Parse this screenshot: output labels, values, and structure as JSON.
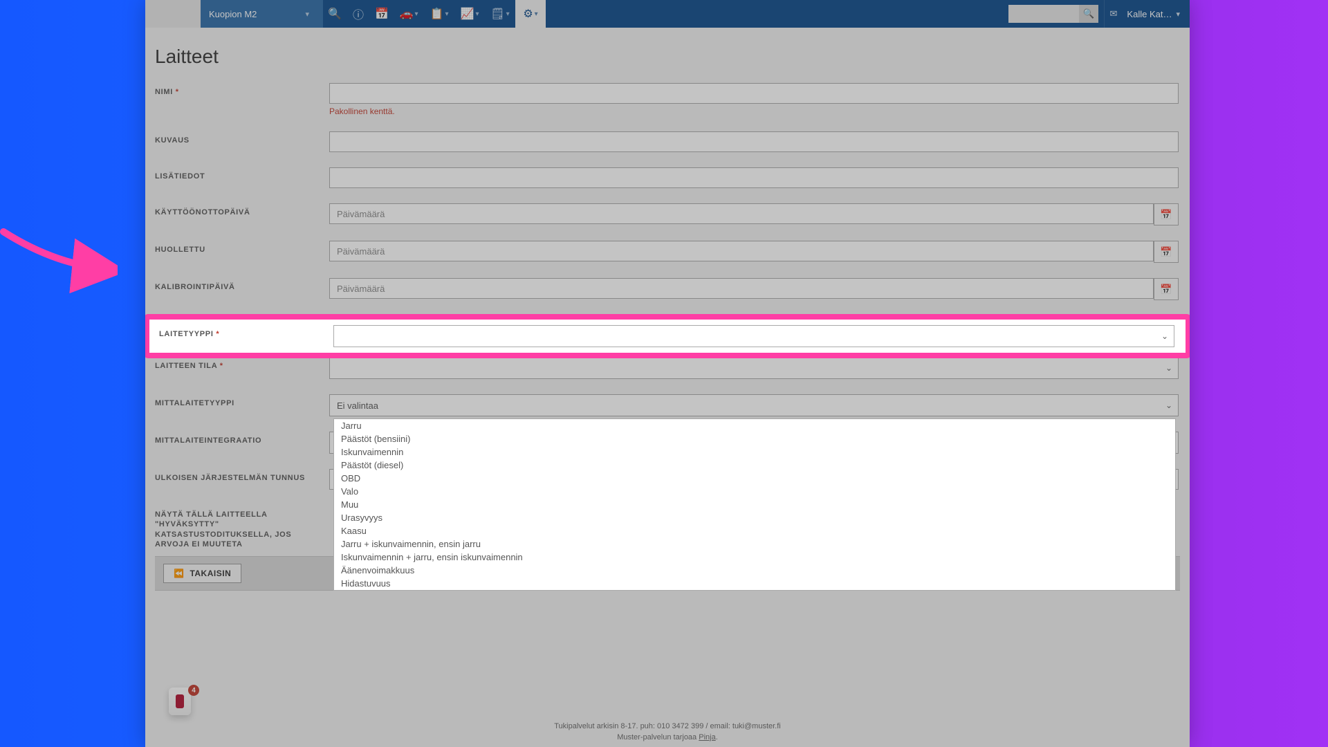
{
  "nav": {
    "station_label": "Kuopion M2",
    "search_placeholder": "",
    "user_name": "Kalle Kat…"
  },
  "page": {
    "title": "Laitteet",
    "error_required": "Pakollinen kenttä."
  },
  "labels": {
    "nimi": "NIMI",
    "kuvaus": "KUVAUS",
    "lisatiedot": "LISÄTIEDOT",
    "kayttoonotto": "KÄYTTÖÖNOTTOPÄIVÄ",
    "huollettu": "HUOLLETTU",
    "kalibrointi": "KALIBROINTIPÄIVÄ",
    "laitetyyppi": "LAITETYYPPI",
    "laitteen_tila": "LAITTEEN TILA",
    "mittalaitetyyppi": "MITTALAITETYYPPI",
    "mittalaiteintegraatio": "MITTALAITEINTEGRAATIO",
    "ulkoinen_tunnus": "ULKOISEN JÄRJESTELMÄN TUNNUS",
    "hyvaksytty_label": "NÄYTÄ TÄLLÄ LAITTEELLA \"HYVÄKSYTTY\" KATSASTUSTODITUKSELLA, JOS ARVOJA EI MUUTETA"
  },
  "placeholders": {
    "date": "Päivämäärä",
    "ei_valintaa": "Ei valintaa"
  },
  "laitetyyppi_options": [
    "Jarru",
    "Päästöt (bensiini)",
    "Iskunvaimennin",
    "Päästöt (diesel)",
    "OBD",
    "Valo",
    "Muu",
    "Urasyvyys",
    "Kaasu",
    "Jarru + iskunvaimennin, ensin jarru",
    "Iskunvaimennin + jarru, ensin iskunvaimennin",
    "Äänenvoimakkuus",
    "Hidastuvuus"
  ],
  "buttons": {
    "back": "TAKAISIN"
  },
  "footer": {
    "line1": "Tukipalvelut arkisin 8-17. puh: 010 3472 399 / email: tuki@muster.fi",
    "line2_prefix": "Muster-palvelun tarjoaa ",
    "line2_link": "Pinja"
  },
  "bubble_badge": "4"
}
